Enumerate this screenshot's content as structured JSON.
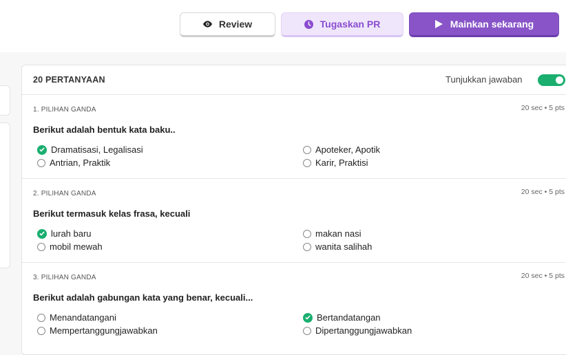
{
  "toolbar": {
    "review_label": "Review",
    "assign_label": "Tugaskan PR",
    "play_label": "Mainkan sekarang"
  },
  "quiz": {
    "count_label": "20 PERTANYAAN",
    "show_answers_label": "Tunjukkan jawaban",
    "show_answers_on": true
  },
  "questions": [
    {
      "type": "1. PILIHAN GANDA",
      "meta": "20 sec • 5 pts",
      "text": "Berikut adalah bentuk kata baku..",
      "options": [
        {
          "label": "Dramatisasi, Legalisasi",
          "correct": true
        },
        {
          "label": "Apoteker, Apotik",
          "correct": false
        },
        {
          "label": "Antrian, Praktik",
          "correct": false
        },
        {
          "label": "Karir, Praktisi",
          "correct": false
        }
      ]
    },
    {
      "type": "2. PILIHAN GANDA",
      "meta": "20 sec • 5 pts",
      "text": "Berikut termasuk kelas frasa, kecuali",
      "options": [
        {
          "label": "lurah baru",
          "correct": true
        },
        {
          "label": "makan nasi",
          "correct": false
        },
        {
          "label": "mobil mewah",
          "correct": false
        },
        {
          "label": "wanita salihah",
          "correct": false
        }
      ]
    },
    {
      "type": "3. PILIHAN GANDA",
      "meta": "20 sec • 5 pts",
      "text": "Berikut adalah gabungan kata yang benar, kecuali...",
      "options": [
        {
          "label": "Menandatangani",
          "correct": false
        },
        {
          "label": "Bertandatangan",
          "correct": true
        },
        {
          "label": "Mempertanggungjawabkan",
          "correct": false
        },
        {
          "label": "Dipertanggungjawabkan",
          "correct": false
        }
      ]
    }
  ]
}
